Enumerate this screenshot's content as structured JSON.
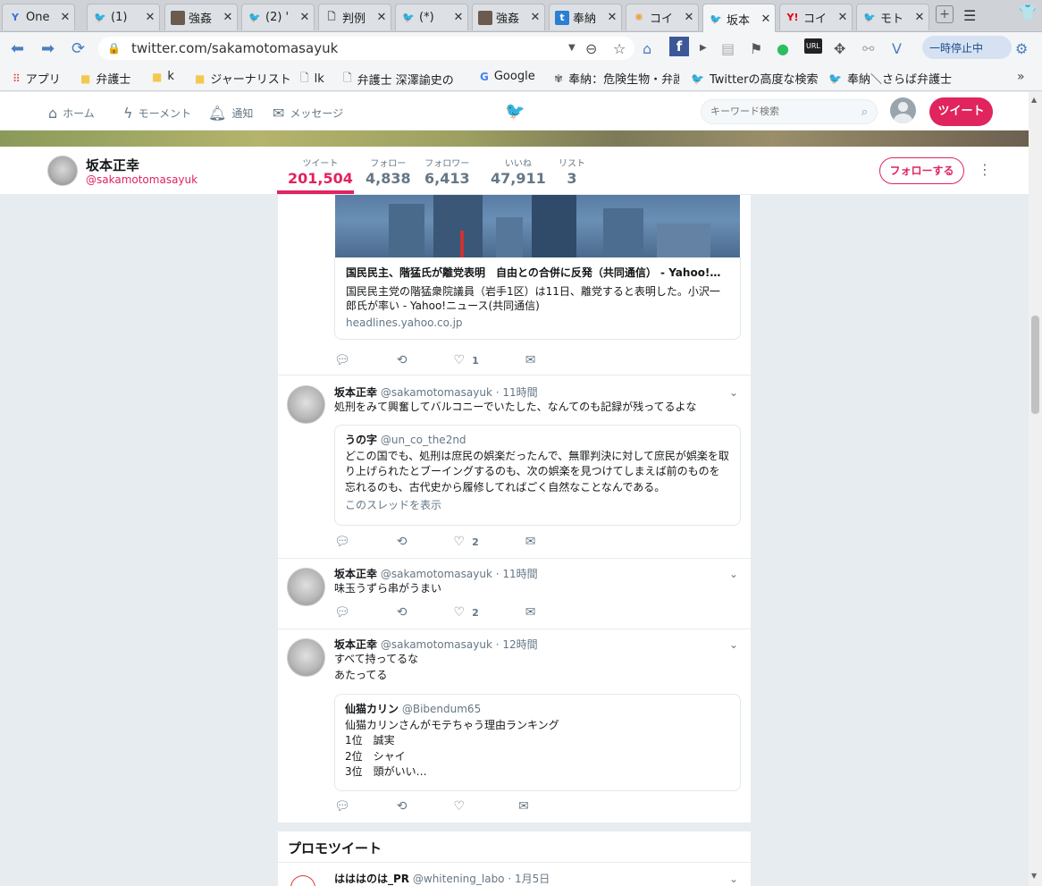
{
  "browser": {
    "tabs": [
      {
        "title": "One",
        "icon": "y-icon"
      },
      {
        "title": "(1) ",
        "icon": "twitter-icon"
      },
      {
        "title": "強姦",
        "icon": "photo-icon"
      },
      {
        "title": "(2) '",
        "icon": "twitter-icon"
      },
      {
        "title": "判例",
        "icon": "document-icon"
      },
      {
        "title": "(*) ",
        "icon": "twitter-icon"
      },
      {
        "title": "強姦",
        "icon": "photo-icon"
      },
      {
        "title": "奉納",
        "icon": "t-icon"
      },
      {
        "title": "コイ",
        "icon": "sun-icon"
      },
      {
        "title": "坂本",
        "icon": "twitter-icon"
      },
      {
        "title": "コイ",
        "icon": "yahoo-icon"
      },
      {
        "title": "モト",
        "icon": "twitter-icon"
      }
    ],
    "active_tab": 9,
    "url": "twitter.com/sakamotomasayuk",
    "pause_label": "一時停止中",
    "bookmarks": [
      {
        "label": "アプリ",
        "icon": "apps-icon"
      },
      {
        "label": "弁護士",
        "icon": "folder-icon"
      },
      {
        "label": "k",
        "icon": "folder-icon"
      },
      {
        "label": "ジャーナリスト",
        "icon": "folder-icon"
      },
      {
        "label": "lk",
        "icon": "page-icon"
      },
      {
        "label": "弁護士 深澤諭史の",
        "icon": "page-icon"
      },
      {
        "label": "Google",
        "icon": "google-icon"
      },
      {
        "label": "奉納：危険生物・弁護",
        "icon": "page-icon"
      },
      {
        "label": "Twitterの高度な検索",
        "icon": "twitter-icon"
      },
      {
        "label": "奉納＼さらば弁護士",
        "icon": "twitter-icon"
      }
    ]
  },
  "twitter_nav": {
    "home": "ホーム",
    "moments": "モーメント",
    "notifications": "通知",
    "messages": "メッセージ",
    "search_placeholder": "キーワード検索",
    "tweet_button": "ツイート"
  },
  "profile": {
    "name": "坂本正幸",
    "handle": "@sakamotomasayuk",
    "stats": [
      {
        "label": "ツイート",
        "value": "201,504"
      },
      {
        "label": "フォロー",
        "value": "4,838"
      },
      {
        "label": "フォロワー",
        "value": "6,413"
      },
      {
        "label": "いいね",
        "value": "47,911"
      },
      {
        "label": "リスト",
        "value": "3"
      }
    ],
    "follow_button": "フォローする"
  },
  "link_card": {
    "title": "国民民主、階猛氏が離党表明　自由との合併に反発（共同通信） - Yahoo!ニ…",
    "desc": "国民民主党の階猛衆院議員（岩手1区）は11日、離党すると表明した。小沢一郎氏が率い - Yahoo!ニュース(共同通信)",
    "domain": "headlines.yahoo.co.jp",
    "likes": "1"
  },
  "tweets": [
    {
      "name": "坂本正幸",
      "handle": "@sakamotomasayuk",
      "time": "· 11時間",
      "text": "処刑をみて興奮してバルコニーでいたした、なんてのも記録が残ってるよな",
      "quote": {
        "name": "うの字",
        "handle": "@un_co_the2nd",
        "text": "どこの国でも、処刑は庶民の娯楽だったんで、無罪判決に対して庶民が娯楽を取り上げられたとブーイングするのも、次の娯楽を見つけてしまえば前のものを忘れるのも、古代史から履修してればごく自然なことなんである。",
        "link": "このスレッドを表示"
      },
      "likes": "2"
    },
    {
      "name": "坂本正幸",
      "handle": "@sakamotomasayuk",
      "time": "· 11時間",
      "text": "味玉うずら串がうまい",
      "likes": "2"
    },
    {
      "name": "坂本正幸",
      "handle": "@sakamotomasayuk",
      "time": "· 12時間",
      "text_line1": "すべて持ってるな",
      "text_line2": "あたってる",
      "quote": {
        "name": "仙猫カリン",
        "handle": "@Bibendum65",
        "line1": "仙猫カリンさんがモテちゃう理由ランキング",
        "line2": "1位　誠実",
        "line3": "2位　シャイ",
        "line4": "3位　頭がいい…"
      },
      "likes": ""
    }
  ],
  "promo": {
    "title": "プロモツイート",
    "name": "はははのは_PR",
    "handle": "@whitening_labo",
    "time": "· 1月5日"
  }
}
